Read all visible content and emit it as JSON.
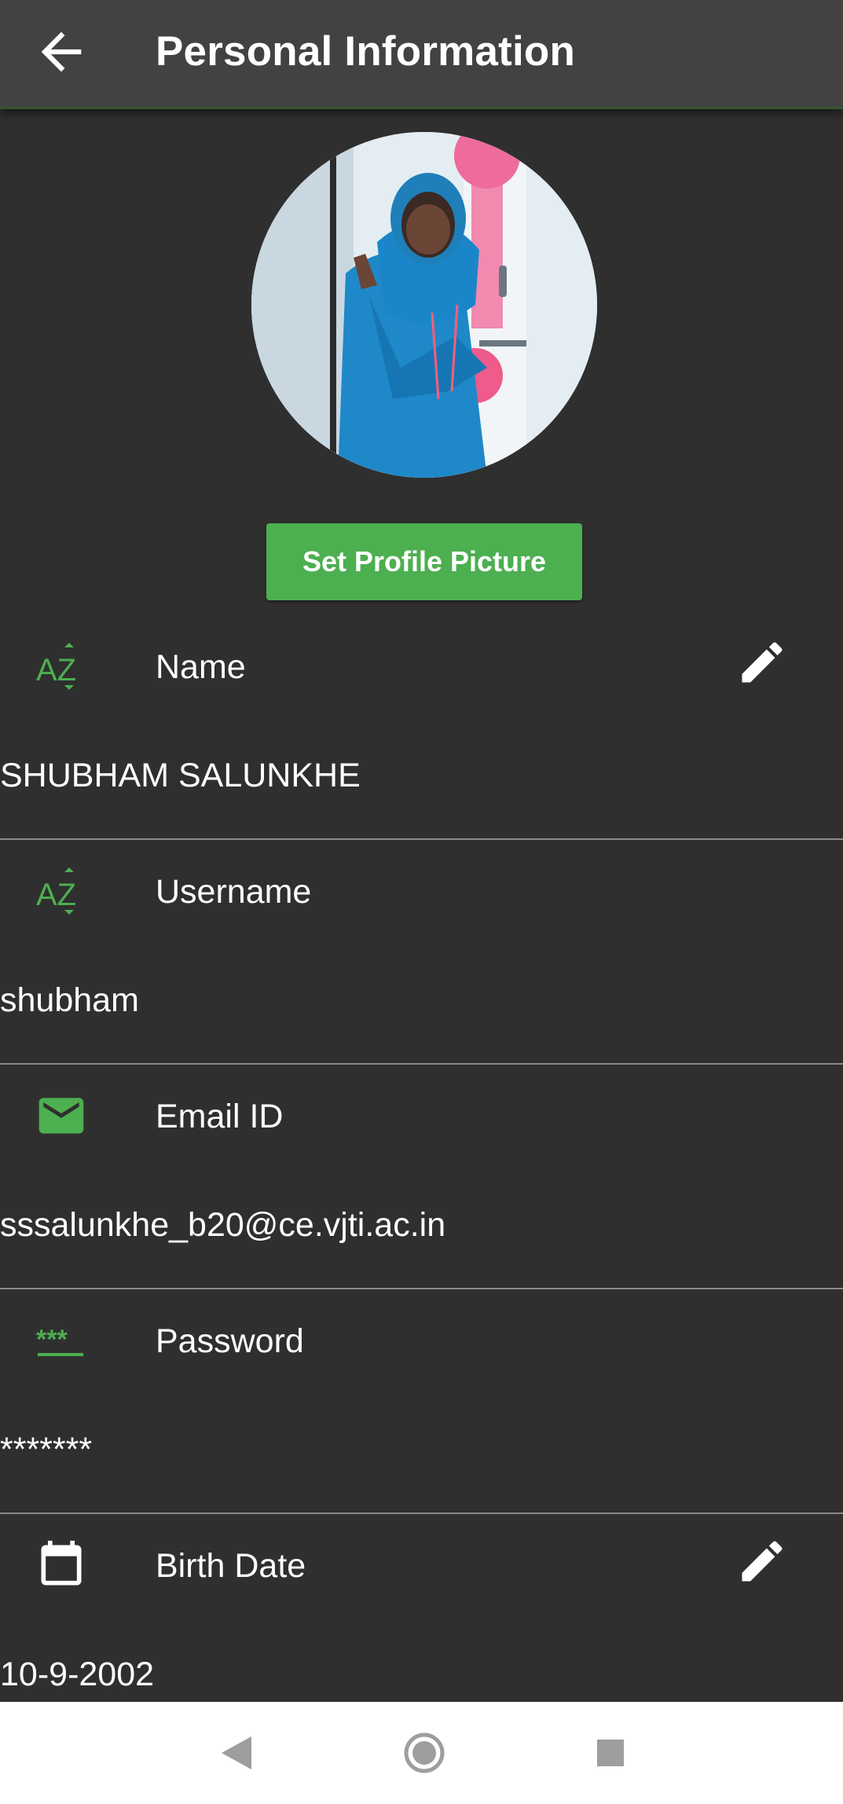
{
  "appbar": {
    "title": "Personal Information",
    "back_icon": "arrow-back-icon"
  },
  "profile": {
    "avatar_icon": "profile-photo",
    "set_picture_label": "Set Profile Picture"
  },
  "colors": {
    "accent": "#4caf50",
    "background": "#2f2f2f",
    "appbar": "#424242",
    "divider": "#8a8a8a"
  },
  "fields": [
    {
      "label": "Name",
      "value": "SHUBHAM SALUNKHE",
      "icon": "text-az-icon",
      "editable": true
    },
    {
      "label": "Username",
      "value": "shubham",
      "icon": "text-az-icon",
      "editable": false
    },
    {
      "label": "Email ID",
      "value": "sssalunkhe_b20@ce.vjti.ac.in",
      "icon": "email-icon",
      "editable": false
    },
    {
      "label": "Password",
      "value": "*******",
      "icon": "password-icon",
      "editable": false
    },
    {
      "label": "Birth Date",
      "value": "10-9-2002",
      "icon": "calendar-icon",
      "editable": true
    }
  ],
  "navbar": {
    "back_icon": "nav-back-icon",
    "home_icon": "nav-home-icon",
    "recents_icon": "nav-recents-icon"
  }
}
